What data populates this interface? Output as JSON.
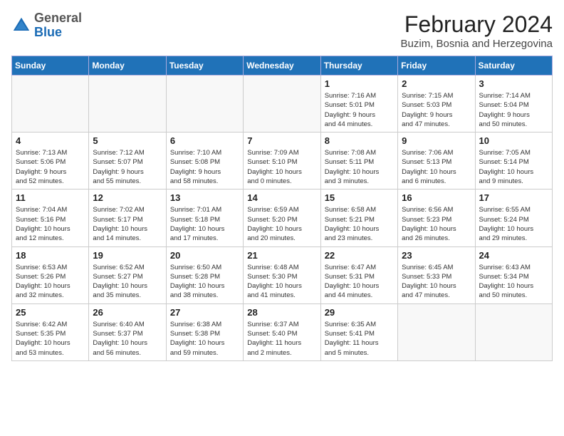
{
  "header": {
    "logo_general": "General",
    "logo_blue": "Blue",
    "month_title": "February 2024",
    "location": "Buzim, Bosnia and Herzegovina"
  },
  "weekdays": [
    "Sunday",
    "Monday",
    "Tuesday",
    "Wednesday",
    "Thursday",
    "Friday",
    "Saturday"
  ],
  "weeks": [
    [
      {
        "day": "",
        "info": ""
      },
      {
        "day": "",
        "info": ""
      },
      {
        "day": "",
        "info": ""
      },
      {
        "day": "",
        "info": ""
      },
      {
        "day": "1",
        "info": "Sunrise: 7:16 AM\nSunset: 5:01 PM\nDaylight: 9 hours\nand 44 minutes."
      },
      {
        "day": "2",
        "info": "Sunrise: 7:15 AM\nSunset: 5:03 PM\nDaylight: 9 hours\nand 47 minutes."
      },
      {
        "day": "3",
        "info": "Sunrise: 7:14 AM\nSunset: 5:04 PM\nDaylight: 9 hours\nand 50 minutes."
      }
    ],
    [
      {
        "day": "4",
        "info": "Sunrise: 7:13 AM\nSunset: 5:06 PM\nDaylight: 9 hours\nand 52 minutes."
      },
      {
        "day": "5",
        "info": "Sunrise: 7:12 AM\nSunset: 5:07 PM\nDaylight: 9 hours\nand 55 minutes."
      },
      {
        "day": "6",
        "info": "Sunrise: 7:10 AM\nSunset: 5:08 PM\nDaylight: 9 hours\nand 58 minutes."
      },
      {
        "day": "7",
        "info": "Sunrise: 7:09 AM\nSunset: 5:10 PM\nDaylight: 10 hours\nand 0 minutes."
      },
      {
        "day": "8",
        "info": "Sunrise: 7:08 AM\nSunset: 5:11 PM\nDaylight: 10 hours\nand 3 minutes."
      },
      {
        "day": "9",
        "info": "Sunrise: 7:06 AM\nSunset: 5:13 PM\nDaylight: 10 hours\nand 6 minutes."
      },
      {
        "day": "10",
        "info": "Sunrise: 7:05 AM\nSunset: 5:14 PM\nDaylight: 10 hours\nand 9 minutes."
      }
    ],
    [
      {
        "day": "11",
        "info": "Sunrise: 7:04 AM\nSunset: 5:16 PM\nDaylight: 10 hours\nand 12 minutes."
      },
      {
        "day": "12",
        "info": "Sunrise: 7:02 AM\nSunset: 5:17 PM\nDaylight: 10 hours\nand 14 minutes."
      },
      {
        "day": "13",
        "info": "Sunrise: 7:01 AM\nSunset: 5:18 PM\nDaylight: 10 hours\nand 17 minutes."
      },
      {
        "day": "14",
        "info": "Sunrise: 6:59 AM\nSunset: 5:20 PM\nDaylight: 10 hours\nand 20 minutes."
      },
      {
        "day": "15",
        "info": "Sunrise: 6:58 AM\nSunset: 5:21 PM\nDaylight: 10 hours\nand 23 minutes."
      },
      {
        "day": "16",
        "info": "Sunrise: 6:56 AM\nSunset: 5:23 PM\nDaylight: 10 hours\nand 26 minutes."
      },
      {
        "day": "17",
        "info": "Sunrise: 6:55 AM\nSunset: 5:24 PM\nDaylight: 10 hours\nand 29 minutes."
      }
    ],
    [
      {
        "day": "18",
        "info": "Sunrise: 6:53 AM\nSunset: 5:26 PM\nDaylight: 10 hours\nand 32 minutes."
      },
      {
        "day": "19",
        "info": "Sunrise: 6:52 AM\nSunset: 5:27 PM\nDaylight: 10 hours\nand 35 minutes."
      },
      {
        "day": "20",
        "info": "Sunrise: 6:50 AM\nSunset: 5:28 PM\nDaylight: 10 hours\nand 38 minutes."
      },
      {
        "day": "21",
        "info": "Sunrise: 6:48 AM\nSunset: 5:30 PM\nDaylight: 10 hours\nand 41 minutes."
      },
      {
        "day": "22",
        "info": "Sunrise: 6:47 AM\nSunset: 5:31 PM\nDaylight: 10 hours\nand 44 minutes."
      },
      {
        "day": "23",
        "info": "Sunrise: 6:45 AM\nSunset: 5:33 PM\nDaylight: 10 hours\nand 47 minutes."
      },
      {
        "day": "24",
        "info": "Sunrise: 6:43 AM\nSunset: 5:34 PM\nDaylight: 10 hours\nand 50 minutes."
      }
    ],
    [
      {
        "day": "25",
        "info": "Sunrise: 6:42 AM\nSunset: 5:35 PM\nDaylight: 10 hours\nand 53 minutes."
      },
      {
        "day": "26",
        "info": "Sunrise: 6:40 AM\nSunset: 5:37 PM\nDaylight: 10 hours\nand 56 minutes."
      },
      {
        "day": "27",
        "info": "Sunrise: 6:38 AM\nSunset: 5:38 PM\nDaylight: 10 hours\nand 59 minutes."
      },
      {
        "day": "28",
        "info": "Sunrise: 6:37 AM\nSunset: 5:40 PM\nDaylight: 11 hours\nand 2 minutes."
      },
      {
        "day": "29",
        "info": "Sunrise: 6:35 AM\nSunset: 5:41 PM\nDaylight: 11 hours\nand 5 minutes."
      },
      {
        "day": "",
        "info": ""
      },
      {
        "day": "",
        "info": ""
      }
    ]
  ]
}
